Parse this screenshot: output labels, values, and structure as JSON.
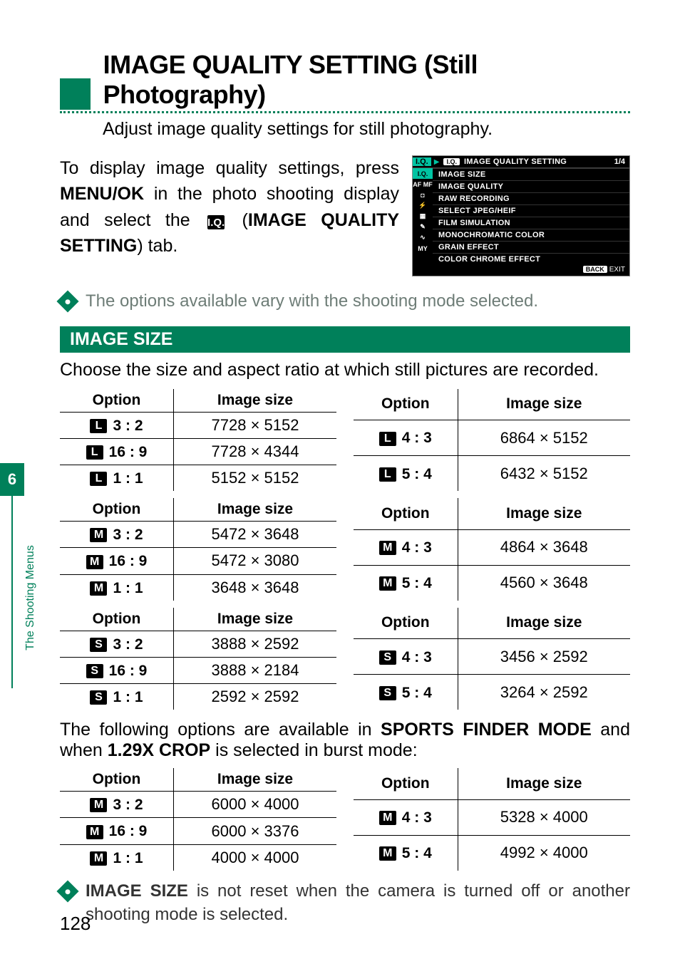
{
  "tab_number": "6",
  "tab_label": "The Shooting Menus",
  "page_number": "128",
  "title": "IMAGE QUALITY SETTING (Still Photography)",
  "subtitle": "Adjust image quality settings for still photography.",
  "intro": {
    "p1a": "To display image quality settings, press ",
    "p1b": "MENU/OK",
    "p1c": " in the photo shooting display and select the ",
    "iq_chip": "I.Q.",
    "p1d": " (",
    "p1e": "IMAGE QUALITY SETTING",
    "p1f": ") tab."
  },
  "lcd": {
    "iq_side": "I.Q.",
    "arrow": "▶",
    "iq_chip": "I.Q.",
    "title": "IMAGE QUALITY SETTING",
    "page": "1/4",
    "sidebar": [
      "I.Q.",
      "AF MF",
      "◘",
      "⚡",
      "▦",
      "✎",
      "∿",
      "MY"
    ],
    "items": [
      "IMAGE SIZE",
      "IMAGE QUALITY",
      "RAW RECORDING",
      "SELECT JPEG/HEIF",
      "FILM SIMULATION",
      "MONOCHROMATIC COLOR",
      "GRAIN EFFECT",
      "COLOR CHROME EFFECT"
    ],
    "back": "BACK",
    "exit": "EXIT"
  },
  "note1": "The options available vary with the shooting mode selected.",
  "section": {
    "heading": "IMAGE SIZE",
    "desc": "Choose the size and aspect ratio at which still pictures are recorded."
  },
  "headers": {
    "option": "Option",
    "size": "Image size"
  },
  "tables": [
    {
      "chip": "L",
      "left": [
        {
          "o": "3 : 2",
          "s": "7728 × 5152"
        },
        {
          "o": "16 : 9",
          "s": "7728 × 4344"
        },
        {
          "o": "1 : 1",
          "s": "5152 × 5152"
        }
      ],
      "right": [
        {
          "o": "4 : 3",
          "s": "6864 × 5152"
        },
        {
          "o": "5 : 4",
          "s": "6432 × 5152"
        }
      ]
    },
    {
      "chip": "M",
      "left": [
        {
          "o": "3 : 2",
          "s": "5472 × 3648"
        },
        {
          "o": "16 : 9",
          "s": "5472 × 3080"
        },
        {
          "o": "1 : 1",
          "s": "3648 × 3648"
        }
      ],
      "right": [
        {
          "o": "4 : 3",
          "s": "4864 × 3648"
        },
        {
          "o": "5 : 4",
          "s": "4560 × 3648"
        }
      ]
    },
    {
      "chip": "S",
      "left": [
        {
          "o": "3 : 2",
          "s": "3888 × 2592"
        },
        {
          "o": "16 : 9",
          "s": "3888 × 2184"
        },
        {
          "o": "1 : 1",
          "s": "2592 × 2592"
        }
      ],
      "right": [
        {
          "o": "4 : 3",
          "s": "3456 × 2592"
        },
        {
          "o": "5 : 4",
          "s": "3264 × 2592"
        }
      ]
    }
  ],
  "sports_note": {
    "a": "The following options are available in ",
    "b": "SPORTS FINDER MODE",
    "c": " and when ",
    "d": "1.29X CROP",
    "e": " is selected in burst mode:"
  },
  "sports_table": {
    "chip": "M",
    "left": [
      {
        "o": "3 : 2",
        "s": "6000 × 4000"
      },
      {
        "o": "16 : 9",
        "s": "6000 × 3376"
      },
      {
        "o": "1 : 1",
        "s": "4000 × 4000"
      }
    ],
    "right": [
      {
        "o": "4 : 3",
        "s": "5328 × 4000"
      },
      {
        "o": "5 : 4",
        "s": "4992 × 4000"
      }
    ]
  },
  "note2": {
    "a": "IMAGE SIZE",
    "b": " is not reset when the camera is turned off or another shooting mode is selected."
  }
}
